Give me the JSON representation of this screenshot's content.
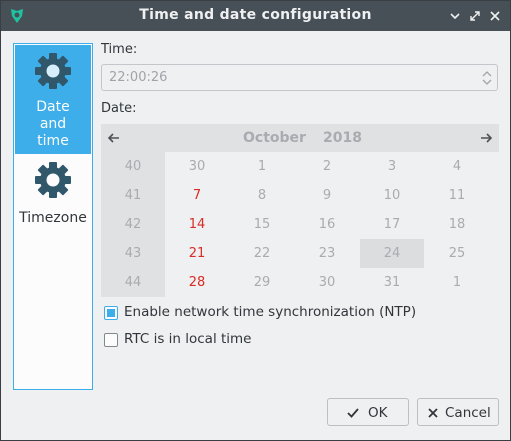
{
  "window": {
    "title": "Time and date configuration",
    "icons": {
      "app": "app-logo-icon",
      "minimize": "minimize-icon",
      "maximize": "maximize-icon",
      "close": "close-icon"
    }
  },
  "sidebar": {
    "items": [
      {
        "label_lines": [
          "Date",
          "and",
          "time"
        ],
        "icon": "gear-icon",
        "active": true
      },
      {
        "label": "Timezone",
        "icon": "gear-icon",
        "active": false
      }
    ]
  },
  "time": {
    "label": "Time:",
    "value": "22:00:26"
  },
  "date": {
    "label": "Date:",
    "month": "October",
    "year": "2018",
    "weeks": [
      {
        "week": "40",
        "days": [
          "30",
          "1",
          "2",
          "3",
          "4"
        ]
      },
      {
        "week": "41",
        "days": [
          "7",
          "8",
          "9",
          "10",
          "11"
        ]
      },
      {
        "week": "42",
        "days": [
          "14",
          "15",
          "16",
          "17",
          "18"
        ]
      },
      {
        "week": "43",
        "days": [
          "21",
          "22",
          "23",
          "24",
          "25"
        ]
      },
      {
        "week": "44",
        "days": [
          "28",
          "29",
          "30",
          "31",
          "1"
        ]
      }
    ],
    "today": "24"
  },
  "options": {
    "ntp_label": "Enable network time synchronization (NTP)",
    "ntp_checked": true,
    "rtc_label": "RTC is in local time",
    "rtc_checked": false
  },
  "buttons": {
    "ok": "OK",
    "cancel": "Cancel"
  },
  "colors": {
    "accent": "#3daee9",
    "titlebar": "#475057",
    "weekend": "#da2b24"
  }
}
